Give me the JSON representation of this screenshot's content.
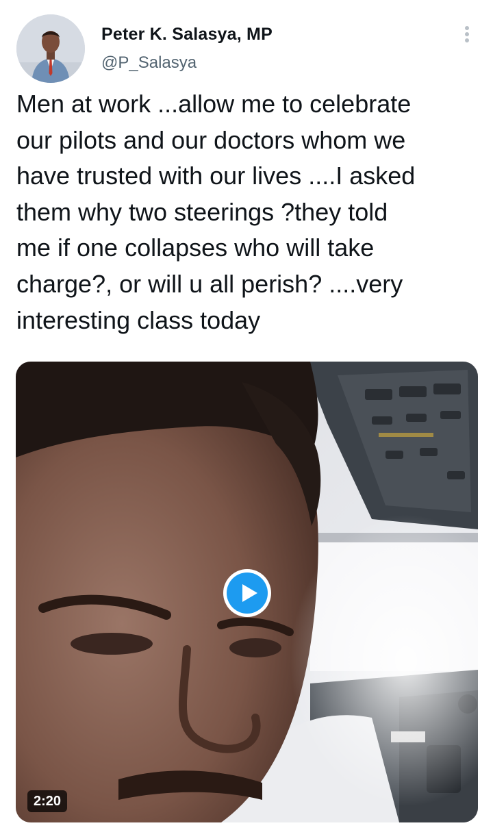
{
  "tweet": {
    "author": {
      "display_name": "Peter K. Salasya, MP",
      "handle": "@P_Salasya",
      "avatar_icon": "profile-photo"
    },
    "more_icon": "more-vertical-icon",
    "text": "Men at work ...allow me to celebrate\nour pilots and our doctors whom we\nhave trusted with our lives ....I asked\nthem why two steerings ?they told\nme if one collapses who will take\ncharge?, or will u all perish? ....very\ninteresting class today",
    "media": {
      "type": "video",
      "duration": "2:20",
      "play_icon": "play-icon",
      "play_color": "#1d9bf0"
    }
  }
}
